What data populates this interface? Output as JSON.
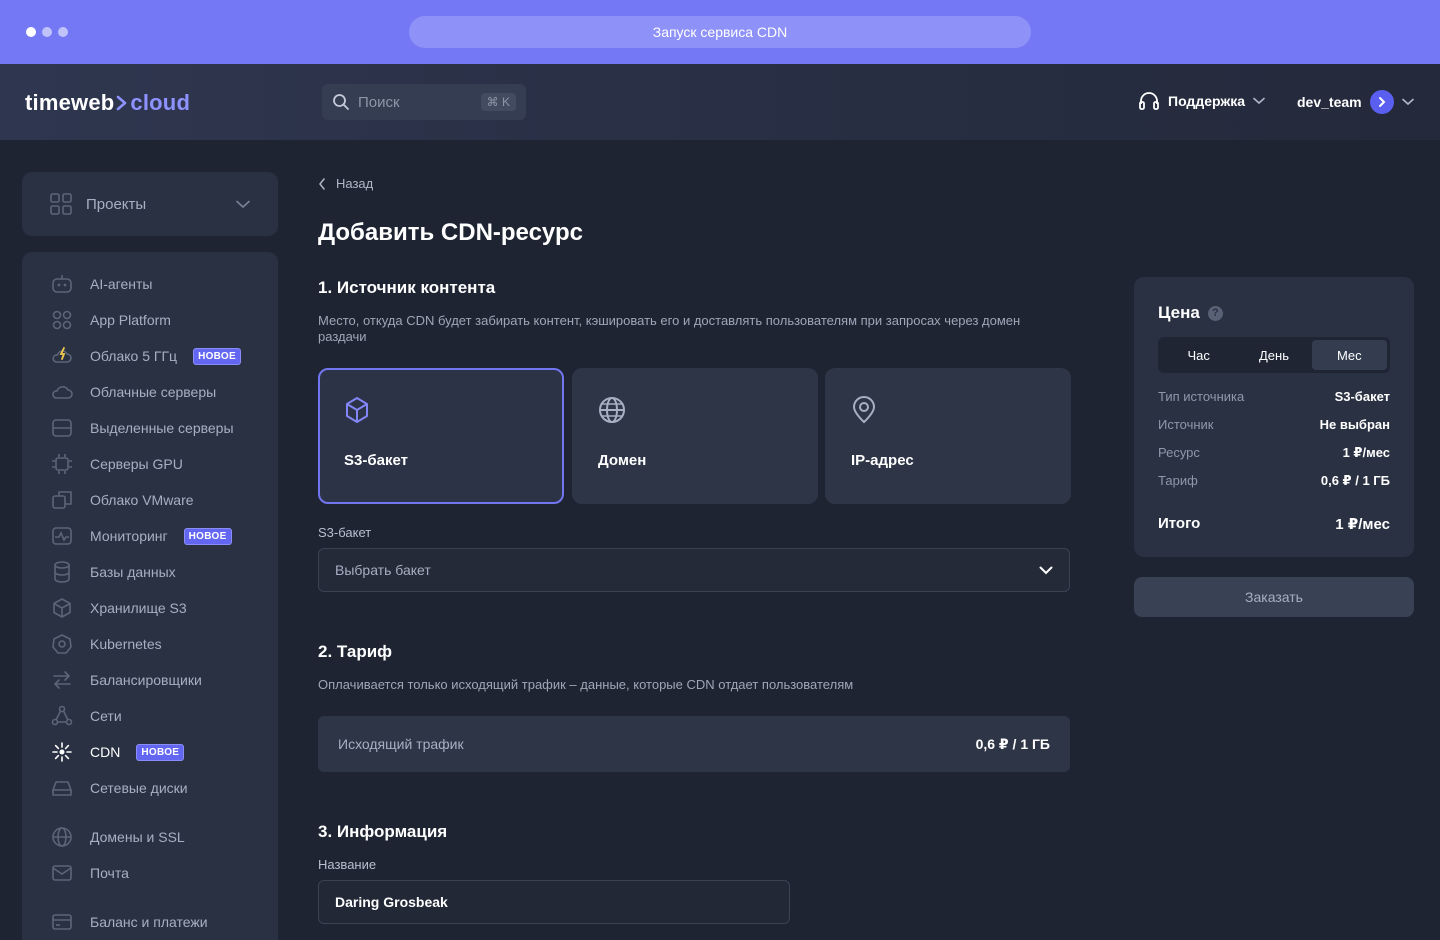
{
  "browser": {
    "url_title": "Запуск сервиса CDN"
  },
  "header": {
    "logo_part1": "timeweb",
    "logo_part2": "cloud",
    "search_placeholder": "Поиск",
    "search_shortcut": "⌘ K",
    "support_label": "Поддержка",
    "user_name": "dev_team"
  },
  "sidebar": {
    "projects_label": "Проекты",
    "items": [
      {
        "label": "AI-агенты",
        "icon": "robot-icon",
        "badge": ""
      },
      {
        "label": "App Platform",
        "icon": "apps-grid-icon",
        "badge": ""
      },
      {
        "label": "Облако 5 ГГц",
        "icon": "cloud-bolt-icon",
        "badge": "НОВОЕ"
      },
      {
        "label": "Облачные серверы",
        "icon": "cloud-icon",
        "badge": ""
      },
      {
        "label": "Выделенные серверы",
        "icon": "server-icon",
        "badge": ""
      },
      {
        "label": "Серверы GPU",
        "icon": "chip-icon",
        "badge": ""
      },
      {
        "label": "Облако VMware",
        "icon": "vmware-icon",
        "badge": ""
      },
      {
        "label": "Мониторинг",
        "icon": "monitoring-icon",
        "badge": "НОВОЕ"
      },
      {
        "label": "Базы данных",
        "icon": "database-icon",
        "badge": ""
      },
      {
        "label": "Хранилище S3",
        "icon": "cube-icon",
        "badge": ""
      },
      {
        "label": "Kubernetes",
        "icon": "kubernetes-icon",
        "badge": ""
      },
      {
        "label": "Балансировщики",
        "icon": "balancer-arrows-icon",
        "badge": ""
      },
      {
        "label": "Сети",
        "icon": "network-icon",
        "badge": ""
      },
      {
        "label": "CDN",
        "icon": "cdn-icon",
        "badge": "НОВОЕ"
      },
      {
        "label": "Сетевые диски",
        "icon": "disk-icon",
        "badge": ""
      },
      {
        "label": "Домены и SSL",
        "icon": "globe-icon",
        "badge": ""
      },
      {
        "label": "Почта",
        "icon": "mail-icon",
        "badge": ""
      },
      {
        "label": "Баланс и платежи",
        "icon": "card-icon",
        "badge": ""
      }
    ]
  },
  "main": {
    "back_label": "Назад",
    "title": "Добавить CDN-ресурс",
    "section1": {
      "title": "1. Источник контента",
      "desc_line1": "Место, откуда CDN будет забирать контент, кэшировать его и доставлять пользователям при запросах через домен",
      "desc_line2": "раздачи",
      "options": [
        {
          "label": "S3-бакет",
          "icon": "cube-icon",
          "selected": true
        },
        {
          "label": "Домен",
          "icon": "globe-icon",
          "selected": false
        },
        {
          "label": "IP-адрес",
          "icon": "location-pin-icon",
          "selected": false
        }
      ],
      "bucket_label": "S3-бакет",
      "bucket_placeholder": "Выбрать бакет"
    },
    "section2": {
      "title": "2. Тариф",
      "desc": "Оплачивается только исходящий трафик – данные, которые CDN отдает пользователям",
      "traffic_label": "Исходящий трафик",
      "traffic_price": "0,6 ₽ / 1 ГБ"
    },
    "section3": {
      "title": "3. Информация",
      "name_label": "Название",
      "name_value": "Daring Grosbeak"
    }
  },
  "price_panel": {
    "title": "Цена",
    "periods": [
      "Час",
      "День",
      "Мес"
    ],
    "selected_period": "Мес",
    "rows": [
      {
        "key": "Тип источника",
        "value": "S3-бакет"
      },
      {
        "key": "Источник",
        "value": "Не выбран"
      },
      {
        "key": "Ресурс",
        "value": "1 ₽/мес"
      },
      {
        "key": "Тариф",
        "value": "0,6 ₽ / 1 ГБ"
      }
    ],
    "total_label": "Итого",
    "total_value": "1 ₽/мес",
    "order_label": "Заказать"
  },
  "colors": {
    "accent": "#6366f1",
    "titlebar": "#7478f5",
    "background": "#1e2431",
    "panel": "#2a3142"
  }
}
